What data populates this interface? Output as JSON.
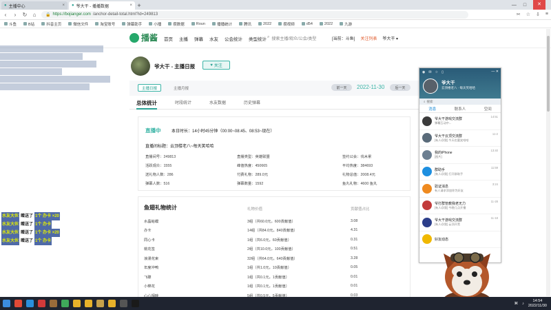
{
  "browser": {
    "tabs": [
      {
        "label": "主播中心"
      },
      {
        "label": "爷大干 - 播播数据",
        "active": true
      }
    ],
    "url_host": "https://bojianger.com",
    "url_path": "/anchor-detail-total.html?id=249813",
    "bookmarks": [
      "斗鱼",
      "B站",
      "抖音主页",
      "微信文件",
      "淘宝账号",
      "弹幕助手",
      "小播",
      "攒数据",
      "Roun",
      "播播统计",
      "腾讯",
      "2022",
      "攒视频",
      "d54",
      "2022",
      "九游"
    ]
  },
  "site": {
    "logo": "播酱",
    "nav": [
      "首页",
      "主播",
      "弹幕",
      "水友",
      "公会统计",
      "类型统计"
    ],
    "search_placeholder": "搜索主播/观众/公会/类型",
    "platform": "[当前：斗鱼]",
    "favorites": "关注列表",
    "user": "爷大干"
  },
  "profile": {
    "name": "爷大干 - 主播日报",
    "follow_label": "关注"
  },
  "report": {
    "tab_daily": "主播日报",
    "tab_monthly": "主播月报",
    "prev_day": "前一天",
    "next_day": "后一天",
    "date": "2022-11-30",
    "subtabs": [
      "总体统计",
      "时段统计",
      "水友数据",
      "历史弹幕"
    ],
    "live_badge": "直播中",
    "live_duration": "本日时长：14小时45分钟（00:00~08:45、08:53~现在）",
    "live_title": "直播间标题：云顶楼老八~每天笑哈哈",
    "stats": [
      "直播间号：249813",
      "直播类型：英雄联盟",
      "签约公会：伐木累",
      "活跃观众：1555",
      "峰值热度：450665",
      "平均热度：384693",
      "送礼物人数：286",
      "付费礼物：289.0元",
      "礼物总值：2008.4元",
      "弹幕人数：516",
      "弹幕数量：1592",
      "鱼丸礼物：4600 鱼丸"
    ],
    "gift_title": "鱼翅礼物统计",
    "gift_col_value": "礼物价值",
    "gift_col_ratio": "贡献值占比",
    "gifts": [
      {
        "name": "水晶蛤蟆",
        "value": "3组（共60.0元，600贡献值）",
        "ratio": "3.08"
      },
      {
        "name": "办卡",
        "value": "14组（共84.0元，840贡献值）",
        "ratio": "4.31"
      },
      {
        "name": "同心卡",
        "value": "1组（共6.0元，60贡献值）",
        "ratio": "0.31"
      },
      {
        "name": "桃花签",
        "value": "2组（共10.0元，100贡献值）",
        "ratio": "0.51"
      },
      {
        "name": "浪漫花束",
        "value": "32组（共64.0元，640贡献值）",
        "ratio": "3.28"
      },
      {
        "name": "年度冲鸭",
        "value": "1组（共1.0元，10贡献值）",
        "ratio": "0.05"
      },
      {
        "name": "飞碟",
        "value": "1组（共0.1元，1贡献值）",
        "ratio": "0.01"
      },
      {
        "name": "小棉花",
        "value": "1组（共0.1元，1贡献值）",
        "ratio": "0.01"
      },
      {
        "name": "心心相映",
        "value": "5组（共0.5元，5贡献值）",
        "ratio": "0.03"
      }
    ]
  },
  "overlay": {
    "gift_feed": [
      {
        "user": "水友大伙",
        "action": "赠送了",
        "gift": "1个 办卡 ×20"
      },
      {
        "user": "水友大伙",
        "action": "赠送了",
        "gift": "1个 办卡"
      },
      {
        "user": "水友大伙",
        "action": "赠送了",
        "gift": "1个 办卡 ×20"
      },
      {
        "user": "水友大伙",
        "action": "赠送了",
        "gift": "1个 办卡"
      }
    ]
  },
  "qq": {
    "name": "爷大干",
    "signature": "云顶楼老八 · 每天笑哈哈",
    "search": "搜索",
    "tabs": [
      "消息",
      "联系人",
      "空间"
    ],
    "messages": [
      {
        "name": "爷大干游戏交流群",
        "msg": "弹幕互动中...",
        "time": "14:51",
        "color": "#3b3b3b"
      },
      {
        "name": "爷大干云顶交流群",
        "msg": "[有人@我] 今天也要笑哈哈",
        "time": "11-2",
        "color": "#5a6b7a"
      },
      {
        "name": "我的iPhone",
        "msg": "[图片]",
        "time": "13:40",
        "color": "#6c7f91"
      },
      {
        "name": "群助手",
        "msg": "[有人@我] 打开群助手",
        "time": "11:59",
        "color": "#1e8fe0"
      },
      {
        "name": "验证消息",
        "msg": "有人请求添加你为好友",
        "time": "3:24",
        "color": "#ef8a1f"
      },
      {
        "name": "爷打群管教我老无力",
        "msg": "[有人@我] 今晚几点开播",
        "time": "11-28",
        "color": "#c23b3b"
      },
      {
        "name": "爷大干游戏交流群",
        "msg": "[有人@我] 云顶开黑",
        "time": "11-18",
        "color": "#2c3e8a"
      },
      {
        "name": "好友动态",
        "msg": "",
        "time": "",
        "color": "#f0b800"
      }
    ]
  },
  "taskbar": {
    "time": "14:54",
    "date": "2022/11/30"
  }
}
